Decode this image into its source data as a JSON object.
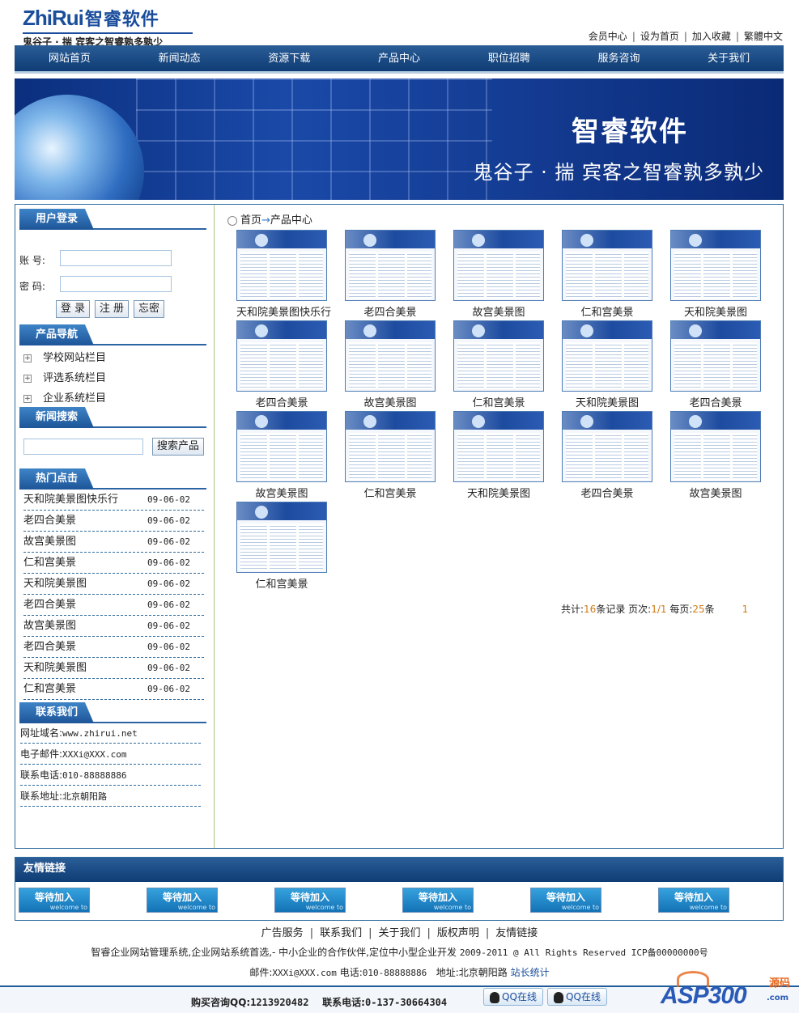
{
  "header": {
    "logo_en": "ZhiRui",
    "logo_cn": "智睿软件",
    "slogan": "鬼谷子 · 揣   宾客之智睿孰多孰少",
    "toplinks": [
      "会员中心",
      "设为首页",
      "加入收藏",
      "繁體中文"
    ]
  },
  "nav": [
    "网站首页",
    "新闻动态",
    "资源下载",
    "产品中心",
    "职位招聘",
    "服务咨询",
    "关于我们"
  ],
  "banner": {
    "title": "智睿软件",
    "subtitle": "鬼谷子 · 揣  宾客之智睿孰多孰少"
  },
  "login": {
    "title": "用户登录",
    "account_label": "账  号:",
    "password_label": "密  码:",
    "account_value": "",
    "password_value": "",
    "buttons": [
      "登 录",
      "注 册",
      "忘密"
    ]
  },
  "product_nav": {
    "title": "产品导航",
    "items": [
      "学校网站栏目",
      "评选系统栏目",
      "企业系统栏目"
    ]
  },
  "news_search": {
    "title": "新闻搜索",
    "input_value": "",
    "button": "搜索产品"
  },
  "hot": {
    "title": "热门点击",
    "items": [
      {
        "name": "天和院美景图快乐行",
        "date": "09-06-02"
      },
      {
        "name": "老四合美景",
        "date": "09-06-02"
      },
      {
        "name": "故宫美景图",
        "date": "09-06-02"
      },
      {
        "name": "仁和宫美景",
        "date": "09-06-02"
      },
      {
        "name": "天和院美景图",
        "date": "09-06-02"
      },
      {
        "name": "老四合美景",
        "date": "09-06-02"
      },
      {
        "name": "故宫美景图",
        "date": "09-06-02"
      },
      {
        "name": "老四合美景",
        "date": "09-06-02"
      },
      {
        "name": "天和院美景图",
        "date": "09-06-02"
      },
      {
        "name": "仁和宫美景",
        "date": "09-06-02"
      }
    ]
  },
  "contact": {
    "title": "联系我们",
    "rows": [
      {
        "label": "网址域名:",
        "value": "www.zhirui.net"
      },
      {
        "label": "电子邮件:",
        "value": "XXXi@XXX.com"
      },
      {
        "label": "联系电话:",
        "value": "010-88888886"
      },
      {
        "label": "联系地址:",
        "value": "北京朝阳路"
      }
    ]
  },
  "breadcrumb": {
    "home": "首页",
    "arrow": "→",
    "current": "产品中心"
  },
  "products": [
    "天和院美景图快乐行",
    "老四合美景",
    "故宫美景图",
    "仁和宫美景",
    "天和院美景图",
    "老四合美景",
    "故宫美景图",
    "仁和宫美景",
    "天和院美景图",
    "老四合美景",
    "故宫美景图",
    "仁和宫美景",
    "天和院美景图",
    "老四合美景",
    "故宫美景图",
    "仁和宫美景"
  ],
  "pager": {
    "total_label": "共计:",
    "total": "16",
    "total_unit": "条记录 页次:",
    "page": "1/1",
    "per_label": " 每页:",
    "per": "25",
    "per_unit": "条",
    "page_num": "1"
  },
  "friend": {
    "title": "友情链接",
    "link_label": "等待加入",
    "link_sub": "welcome to",
    "count": 6
  },
  "footer": {
    "links": [
      "广告服务",
      "联系我们",
      "关于我们",
      "版权声明",
      "友情链接"
    ],
    "copyright_cn": "智睿企业网站管理系统,企业网站系统首选,- 中小企业的合作伙伴,定位中小型企业开发",
    "copyright_en": "2009-2011 @ All Rights Reserved ICP备00000000号",
    "mail_label": "邮件:",
    "mail": "XXXi@XXX.com",
    "phone_label": "电话:",
    "phone": "010-88888886",
    "address_label": "地址:",
    "address": "北京朝阳路",
    "stat": "站长统计"
  },
  "bottom": {
    "buy_qq_label": "购买咨询QQ:",
    "buy_qq": "1213920482",
    "buy_phone_label": "联系电话:",
    "buy_phone": "0-137-30664304",
    "qq_buttons": [
      "QQ在线",
      "QQ在线"
    ]
  },
  "watermark": {
    "brand": "ASP300",
    "tag": "源码",
    "domain": ".com"
  },
  "colors": {
    "primary": "#1a4d9c",
    "nav_dark": "#0f3c74",
    "accent": "#d07a16"
  }
}
